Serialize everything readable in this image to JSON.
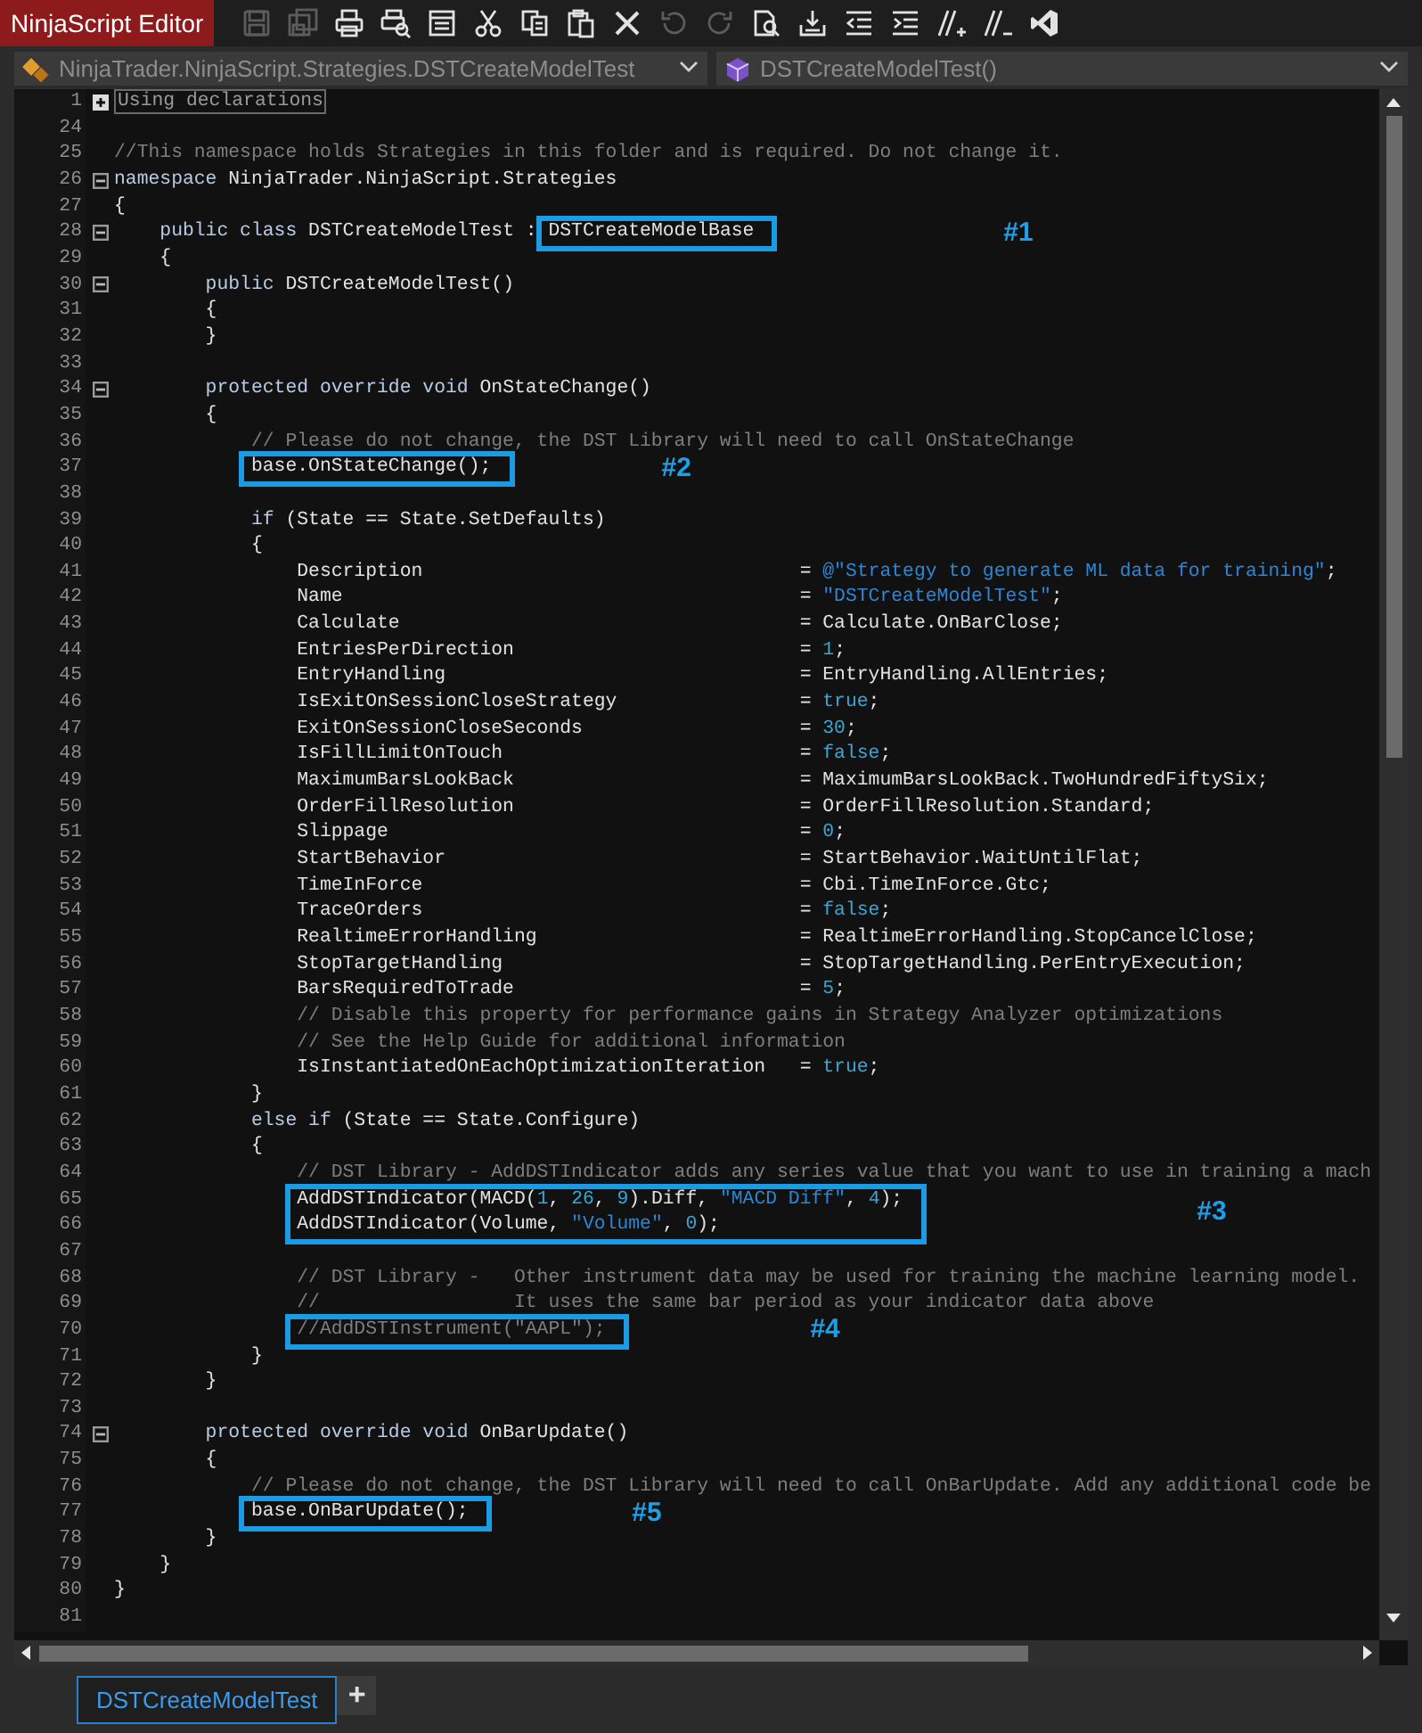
{
  "window": {
    "title": "NinjaScript Editor"
  },
  "toolbar": [
    {
      "kind": "save",
      "disabled": true
    },
    {
      "kind": "save_all",
      "disabled": true
    },
    {
      "kind": "print",
      "disabled": false
    },
    {
      "kind": "print_preview",
      "disabled": false
    },
    {
      "kind": "form",
      "disabled": false
    },
    {
      "kind": "cut",
      "disabled": false
    },
    {
      "kind": "copy",
      "disabled": false
    },
    {
      "kind": "paste",
      "disabled": false
    },
    {
      "kind": "delete",
      "disabled": false
    },
    {
      "kind": "undo",
      "disabled": true
    },
    {
      "kind": "redo",
      "disabled": true
    },
    {
      "kind": "find",
      "disabled": false
    },
    {
      "kind": "compile",
      "disabled": false
    },
    {
      "kind": "outdent",
      "disabled": false
    },
    {
      "kind": "indent",
      "disabled": false
    },
    {
      "kind": "comment",
      "disabled": false
    },
    {
      "kind": "uncomment",
      "disabled": false
    },
    {
      "kind": "visual_studio",
      "disabled": false
    }
  ],
  "selectors": [
    {
      "kind": "namespace",
      "text": "NinjaTrader.NinjaScript.Strategies.DSTCreateModelTest"
    },
    {
      "kind": "member",
      "text": "DSTCreateModelTest()"
    }
  ],
  "editor": {
    "lines": [
      {
        "kind": "line",
        "n": "1",
        "foldable": true,
        "expanded": false,
        "code": [
          {
            "t": "Using declarations",
            "kind": "collapsed"
          }
        ]
      },
      {
        "kind": "line",
        "n": "24"
      },
      {
        "kind": "line",
        "n": "25",
        "code": [
          {
            "t": "//This namespace holds Strategies in this folder and is required. Do not change it.",
            "kind": "comment"
          }
        ]
      },
      {
        "kind": "line",
        "n": "26",
        "foldable": true,
        "expanded": true,
        "code": [
          {
            "t": "namespace",
            "kind": "keyword"
          },
          {
            "t": " NinjaTrader.NinjaScript.Strategies",
            "kind": "plain"
          }
        ]
      },
      {
        "kind": "line",
        "n": "27",
        "code": [
          {
            "t": "{",
            "kind": "plain"
          }
        ]
      },
      {
        "kind": "callout",
        "label": "#1",
        "lines": [
          {
            "kind": "line",
            "n": "28",
            "foldable": true,
            "expanded": true,
            "code": [
              {
                "t": "    public class",
                "kind": "keyword"
              },
              {
                "t": " DSTCreateModelTest : ",
                "kind": "plain"
              },
              {
                "t": "DSTCreateModelBase",
                "kind": "plain",
                "boxed": true
              }
            ]
          }
        ]
      },
      {
        "kind": "line",
        "n": "29",
        "code": [
          {
            "t": "    {",
            "kind": "plain"
          }
        ]
      },
      {
        "kind": "line",
        "n": "30",
        "foldable": true,
        "expanded": true,
        "code": [
          {
            "t": "        public",
            "kind": "keyword"
          },
          {
            "t": " DSTCreateModelTest()",
            "kind": "plain"
          }
        ]
      },
      {
        "kind": "line",
        "n": "31",
        "code": [
          {
            "t": "        {",
            "kind": "plain"
          }
        ]
      },
      {
        "kind": "line",
        "n": "32",
        "code": [
          {
            "t": "        }",
            "kind": "plain"
          }
        ]
      },
      {
        "kind": "line",
        "n": "33"
      },
      {
        "kind": "line",
        "n": "34",
        "foldable": true,
        "expanded": true,
        "code": [
          {
            "t": "        protected override void",
            "kind": "keyword"
          },
          {
            "t": " OnStateChange()",
            "kind": "plain"
          }
        ]
      },
      {
        "kind": "line",
        "n": "35",
        "code": [
          {
            "t": "        {",
            "kind": "plain"
          }
        ]
      },
      {
        "kind": "line",
        "n": "36",
        "code": [
          {
            "t": "            // Please do not change, the DST Library will need to call OnStateChange",
            "kind": "comment"
          }
        ]
      },
      {
        "kind": "callout",
        "label": "#2",
        "lines": [
          {
            "kind": "line",
            "n": "37",
            "code": [
              {
                "t": "            base.OnStateChange();",
                "kind": "plain",
                "boxed": true
              }
            ]
          }
        ]
      },
      {
        "kind": "line",
        "n": "38"
      },
      {
        "kind": "line",
        "n": "39",
        "code": [
          {
            "t": "            if",
            "kind": "keyword"
          },
          {
            "t": " (State == State.SetDefaults)",
            "kind": "plain"
          }
        ]
      },
      {
        "kind": "line",
        "n": "40",
        "code": [
          {
            "t": "            {",
            "kind": "plain"
          }
        ]
      },
      {
        "kind": "line",
        "n": "41",
        "code": [
          {
            "t": "                Description",
            "kind": "plain"
          }
        ],
        "value": [
          {
            "t": "= ",
            "kind": "plain"
          },
          {
            "t": "@\"Strategy to generate ML data for training\"",
            "kind": "string"
          },
          {
            "t": ";",
            "kind": "plain"
          }
        ]
      },
      {
        "kind": "line",
        "n": "42",
        "code": [
          {
            "t": "                Name",
            "kind": "plain"
          }
        ],
        "value": [
          {
            "t": "= ",
            "kind": "plain"
          },
          {
            "t": "\"DSTCreateModelTest\"",
            "kind": "string"
          },
          {
            "t": ";",
            "kind": "plain"
          }
        ]
      },
      {
        "kind": "line",
        "n": "43",
        "code": [
          {
            "t": "                Calculate",
            "kind": "plain"
          }
        ],
        "value": [
          {
            "t": "= Calculate.OnBarClose;",
            "kind": "plain"
          }
        ]
      },
      {
        "kind": "line",
        "n": "44",
        "code": [
          {
            "t": "                EntriesPerDirection",
            "kind": "plain"
          }
        ],
        "value": [
          {
            "t": "= ",
            "kind": "plain"
          },
          {
            "t": "1",
            "kind": "literal"
          },
          {
            "t": ";",
            "kind": "plain"
          }
        ]
      },
      {
        "kind": "line",
        "n": "45",
        "code": [
          {
            "t": "                EntryHandling",
            "kind": "plain"
          }
        ],
        "value": [
          {
            "t": "= EntryHandling.AllEntries;",
            "kind": "plain"
          }
        ]
      },
      {
        "kind": "line",
        "n": "46",
        "code": [
          {
            "t": "                IsExitOnSessionCloseStrategy",
            "kind": "plain"
          }
        ],
        "value": [
          {
            "t": "= ",
            "kind": "plain"
          },
          {
            "t": "true",
            "kind": "literal"
          },
          {
            "t": ";",
            "kind": "plain"
          }
        ]
      },
      {
        "kind": "line",
        "n": "47",
        "code": [
          {
            "t": "                ExitOnSessionCloseSeconds",
            "kind": "plain"
          }
        ],
        "value": [
          {
            "t": "= ",
            "kind": "plain"
          },
          {
            "t": "30",
            "kind": "literal"
          },
          {
            "t": ";",
            "kind": "plain"
          }
        ]
      },
      {
        "kind": "line",
        "n": "48",
        "code": [
          {
            "t": "                IsFillLimitOnTouch",
            "kind": "plain"
          }
        ],
        "value": [
          {
            "t": "= ",
            "kind": "plain"
          },
          {
            "t": "false",
            "kind": "literal"
          },
          {
            "t": ";",
            "kind": "plain"
          }
        ]
      },
      {
        "kind": "line",
        "n": "49",
        "code": [
          {
            "t": "                MaximumBarsLookBack",
            "kind": "plain"
          }
        ],
        "value": [
          {
            "t": "= MaximumBarsLookBack.TwoHundredFiftySix;",
            "kind": "plain"
          }
        ]
      },
      {
        "kind": "line",
        "n": "50",
        "code": [
          {
            "t": "                OrderFillResolution",
            "kind": "plain"
          }
        ],
        "value": [
          {
            "t": "= OrderFillResolution.Standard;",
            "kind": "plain"
          }
        ]
      },
      {
        "kind": "line",
        "n": "51",
        "code": [
          {
            "t": "                Slippage",
            "kind": "plain"
          }
        ],
        "value": [
          {
            "t": "= ",
            "kind": "plain"
          },
          {
            "t": "0",
            "kind": "literal"
          },
          {
            "t": ";",
            "kind": "plain"
          }
        ]
      },
      {
        "kind": "line",
        "n": "52",
        "code": [
          {
            "t": "                StartBehavior",
            "kind": "plain"
          }
        ],
        "value": [
          {
            "t": "= StartBehavior.WaitUntilFlat;",
            "kind": "plain"
          }
        ]
      },
      {
        "kind": "line",
        "n": "53",
        "code": [
          {
            "t": "                TimeInForce",
            "kind": "plain"
          }
        ],
        "value": [
          {
            "t": "= Cbi.TimeInForce.Gtc;",
            "kind": "plain"
          }
        ]
      },
      {
        "kind": "line",
        "n": "54",
        "code": [
          {
            "t": "                TraceOrders",
            "kind": "plain"
          }
        ],
        "value": [
          {
            "t": "= ",
            "kind": "plain"
          },
          {
            "t": "false",
            "kind": "literal"
          },
          {
            "t": ";",
            "kind": "plain"
          }
        ]
      },
      {
        "kind": "line",
        "n": "55",
        "code": [
          {
            "t": "                RealtimeErrorHandling",
            "kind": "plain"
          }
        ],
        "value": [
          {
            "t": "= RealtimeErrorHandling.StopCancelClose;",
            "kind": "plain"
          }
        ]
      },
      {
        "kind": "line",
        "n": "56",
        "code": [
          {
            "t": "                StopTargetHandling",
            "kind": "plain"
          }
        ],
        "value": [
          {
            "t": "= StopTargetHandling.PerEntryExecution;",
            "kind": "plain"
          }
        ]
      },
      {
        "kind": "line",
        "n": "57",
        "code": [
          {
            "t": "                BarsRequiredToTrade",
            "kind": "plain"
          }
        ],
        "value": [
          {
            "t": "= ",
            "kind": "plain"
          },
          {
            "t": "5",
            "kind": "literal"
          },
          {
            "t": ";",
            "kind": "plain"
          }
        ]
      },
      {
        "kind": "line",
        "n": "58",
        "code": [
          {
            "t": "                // Disable this property for performance gains in Strategy Analyzer optimizations",
            "kind": "comment"
          }
        ]
      },
      {
        "kind": "line",
        "n": "59",
        "code": [
          {
            "t": "                // See the Help Guide for additional information",
            "kind": "comment"
          }
        ]
      },
      {
        "kind": "line",
        "n": "60",
        "code": [
          {
            "t": "                IsInstantiatedOnEachOptimizationIteration",
            "kind": "plain"
          }
        ],
        "value": [
          {
            "t": "= ",
            "kind": "plain"
          },
          {
            "t": "true",
            "kind": "literal"
          },
          {
            "t": ";",
            "kind": "plain"
          }
        ]
      },
      {
        "kind": "line",
        "n": "61",
        "code": [
          {
            "t": "            }",
            "kind": "plain"
          }
        ]
      },
      {
        "kind": "line",
        "n": "62",
        "code": [
          {
            "t": "            else if",
            "kind": "keyword"
          },
          {
            "t": " (State == State.Configure)",
            "kind": "plain"
          }
        ]
      },
      {
        "kind": "line",
        "n": "63",
        "code": [
          {
            "t": "            {",
            "kind": "plain"
          }
        ]
      },
      {
        "kind": "line",
        "n": "64",
        "code": [
          {
            "t": "                // DST Library - AddDSTIndicator adds any series value that you want to use in training a mach",
            "kind": "comment"
          }
        ]
      },
      {
        "kind": "callout",
        "label": "#3",
        "lines": [
          {
            "kind": "line",
            "n": "65",
            "code": [
              {
                "t": "                AddDSTIndicator(MACD(",
                "kind": "plain",
                "boxed": true
              },
              {
                "t": "1",
                "kind": "literal"
              },
              {
                "t": ", ",
                "kind": "plain"
              },
              {
                "t": "26",
                "kind": "literal"
              },
              {
                "t": ", ",
                "kind": "plain"
              },
              {
                "t": "9",
                "kind": "literal"
              },
              {
                "t": ").Diff, ",
                "kind": "plain"
              },
              {
                "t": "\"MACD Diff\"",
                "kind": "string"
              },
              {
                "t": ", ",
                "kind": "plain"
              },
              {
                "t": "4",
                "kind": "literal"
              },
              {
                "t": ");",
                "kind": "plain"
              }
            ]
          },
          {
            "kind": "line",
            "n": "66",
            "code": [
              {
                "t": "                AddDSTIndicator(Volume, ",
                "kind": "plain",
                "boxed": true
              },
              {
                "t": "\"Volume\"",
                "kind": "string"
              },
              {
                "t": ", ",
                "kind": "plain"
              },
              {
                "t": "0",
                "kind": "literal"
              },
              {
                "t": ");",
                "kind": "plain"
              }
            ]
          }
        ]
      },
      {
        "kind": "line",
        "n": "67"
      },
      {
        "kind": "line",
        "n": "68",
        "code": [
          {
            "t": "                // DST Library -   Other instrument data may be used for training the machine learning model.",
            "kind": "comment"
          }
        ]
      },
      {
        "kind": "line",
        "n": "69",
        "code": [
          {
            "t": "                //                 It uses the same bar period as your indicator data above",
            "kind": "comment"
          }
        ]
      },
      {
        "kind": "callout",
        "label": "#4",
        "lines": [
          {
            "kind": "line",
            "n": "70",
            "code": [
              {
                "t": "                //AddDSTInstrument(\"AAPL\");",
                "kind": "comment",
                "boxed": true
              }
            ]
          }
        ]
      },
      {
        "kind": "line",
        "n": "71",
        "code": [
          {
            "t": "            }",
            "kind": "plain"
          }
        ]
      },
      {
        "kind": "line",
        "n": "72",
        "code": [
          {
            "t": "        }",
            "kind": "plain"
          }
        ]
      },
      {
        "kind": "line",
        "n": "73"
      },
      {
        "kind": "line",
        "n": "74",
        "foldable": true,
        "expanded": true,
        "code": [
          {
            "t": "        protected override void",
            "kind": "keyword"
          },
          {
            "t": " OnBarUpdate()",
            "kind": "plain"
          }
        ]
      },
      {
        "kind": "line",
        "n": "75",
        "code": [
          {
            "t": "        {",
            "kind": "plain"
          }
        ]
      },
      {
        "kind": "line",
        "n": "76",
        "code": [
          {
            "t": "            // Please do not change, the DST Library will need to call OnBarUpdate. Add any additional code be",
            "kind": "comment"
          }
        ]
      },
      {
        "kind": "callout",
        "label": "#5",
        "lines": [
          {
            "kind": "line",
            "n": "77",
            "code": [
              {
                "t": "            base.OnBarUpdate();",
                "kind": "plain",
                "boxed": true
              }
            ]
          }
        ]
      },
      {
        "kind": "line",
        "n": "78",
        "code": [
          {
            "t": "        }",
            "kind": "plain"
          }
        ]
      },
      {
        "kind": "line",
        "n": "79",
        "code": [
          {
            "t": "    }",
            "kind": "plain"
          }
        ]
      },
      {
        "kind": "line",
        "n": "80",
        "code": [
          {
            "t": "}",
            "kind": "plain"
          }
        ]
      },
      {
        "kind": "line",
        "n": "81"
      }
    ]
  },
  "tabs": [
    {
      "label": "DSTCreateModelTest",
      "selected": true
    }
  ],
  "new_tab": {
    "label": "+"
  }
}
